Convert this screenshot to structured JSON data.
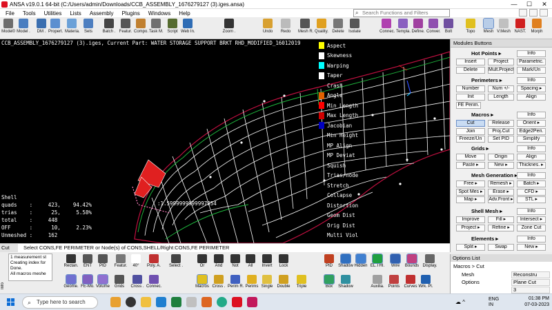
{
  "window": {
    "title": "ANSA v19.0.1 64-bit (C:/Users/admin/Downloads/CCB_ASSEMBLY_1676279127 (3).iges.ansa)",
    "minimize": "—",
    "maximize": "☐",
    "close": "✕"
  },
  "menu": [
    "File",
    "Tools",
    "Utilities",
    "Lists",
    "Assembly",
    "Plugins",
    "Windows",
    "Help"
  ],
  "search": {
    "placeholder": "Search Functions and Filters"
  },
  "toolbar": [
    {
      "label": "Model0",
      "icon": "model-icon",
      "color": "#6d6d6d"
    },
    {
      "label": "Model .",
      "icon": "model-browser-icon",
      "color": "#4a7ec0"
    },
    {
      "label": "DM .",
      "icon": "data-management-icon",
      "color": "#3b6fb0"
    },
    {
      "label": "Propert.",
      "icon": "properties-icon",
      "color": "#5c8fd0"
    },
    {
      "label": "Materia.",
      "icon": "materials-icon",
      "color": "#6ba1d8"
    },
    {
      "label": "Sets",
      "icon": "sets-icon",
      "color": "#4e7fc0"
    },
    {
      "label": "Batch .",
      "icon": "batch-icon",
      "color": "#444444"
    },
    {
      "label": "Featur.",
      "icon": "features-icon",
      "color": "#555555"
    },
    {
      "label": "Compo.",
      "icon": "components-icon",
      "color": "#c08030"
    },
    {
      "label": "Task M.",
      "icon": "task-manager-icon",
      "color": "#707070"
    },
    {
      "label": "Script",
      "icon": "script-icon",
      "color": "#556b2f"
    },
    {
      "label": "Web In.",
      "icon": "web-icon",
      "color": "#2f6db5"
    },
    {
      "label": "Zoom .",
      "icon": "zoom-icon",
      "color": "#333333"
    },
    {
      "label": "Undo",
      "icon": "undo-icon",
      "color": "#d8a030"
    },
    {
      "label": "Redo",
      "icon": "redo-icon",
      "color": "#bbbbbb"
    },
    {
      "label": "Mesh R.",
      "icon": "mesh-repair-icon",
      "color": "#555555"
    },
    {
      "label": "Quality.",
      "icon": "quality-icon",
      "color": "#e0a020"
    },
    {
      "label": "Delete",
      "icon": "delete-icon",
      "color": "#777777"
    },
    {
      "label": "Isolate",
      "icon": "isolate-icon",
      "color": "#555555"
    },
    {
      "label": "Connec.",
      "icon": "connections-icon",
      "color": "#b040b0"
    },
    {
      "label": "Templa.",
      "icon": "template-icon",
      "color": "#8a60c0"
    },
    {
      "label": "Define.",
      "icon": "define-icon",
      "color": "#a040a0"
    },
    {
      "label": "Conver.",
      "icon": "convert-icon",
      "color": "#9050b0"
    },
    {
      "label": "Bolt",
      "icon": "bolt-icon",
      "color": "#7050a0"
    },
    {
      "label": "Topo",
      "icon": "topo-icon",
      "color": "#e0c020"
    },
    {
      "label": "Mesh",
      "icon": "mesh-icon",
      "color": "#a0a0a0"
    },
    {
      "label": "V.Mesh",
      "icon": "volume-mesh-icon",
      "color": "#c0c0c0"
    },
    {
      "label": "NAST.",
      "icon": "nastran-icon",
      "color": "#d02020"
    },
    {
      "label": "Morph",
      "icon": "morph-icon",
      "color": "#e08020"
    }
  ],
  "viewport": {
    "title": "CCB_ASSEMBLY_1676279127 (3).iges,  Current Part: WATER STORAGE SUPPORT BRKT RHD_MODIFIED_16012019",
    "legend": [
      {
        "label": "Aspect",
        "color": "#ffff00"
      },
      {
        "label": "Skewness",
        "color": "#ffffff"
      },
      {
        "label": "Warping",
        "color": "#00ffff"
      },
      {
        "label": "Taper",
        "color": "#ffffff"
      },
      {
        "label": "Crash",
        "color": ""
      },
      {
        "label": "Angle",
        "color": "#e06000"
      },
      {
        "label": "Min Length",
        "color": "#ff0000"
      },
      {
        "label": "Max Length",
        "color": "#d00000"
      },
      {
        "label": "Jacobian",
        "color": "#0000c0"
      },
      {
        "label": "Min Height",
        "color": ""
      },
      {
        "label": "MP Align",
        "color": ""
      },
      {
        "label": "MP Deviat",
        "color": ""
      },
      {
        "label": "Squish",
        "color": ""
      },
      {
        "label": "Trias/node",
        "color": ""
      },
      {
        "label": "Stretch",
        "color": ""
      },
      {
        "label": "Collapse",
        "color": ""
      },
      {
        "label": "Distortion",
        "color": ""
      },
      {
        "label": "Geom Dist",
        "color": ""
      },
      {
        "label": "Orig Dist",
        "color": ""
      },
      {
        "label": "Multi Viol",
        "color": ""
      }
    ],
    "stats": [
      "Shell",
      "quads    :     423,    94.42%",
      "trias    :      25,     5.58%",
      "total    :     448",
      "OFF      :      10,     2.23%",
      "Unmeshed :     162"
    ],
    "measure": ":1.5999999999997954"
  },
  "modules": {
    "header": "Modules Buttons",
    "hot_points": {
      "title": "Hot Points ▸",
      "info": "Info",
      "buttons": [
        "Insert",
        "Project",
        "Parametric.",
        "Delete",
        "Mult.Project",
        "Mark/Un"
      ]
    },
    "perimeters": {
      "title": "Perimeters ▸",
      "info": "Info",
      "buttons": [
        "Number",
        "Num +/-",
        "Spacing ▸",
        "Init",
        "Length",
        "Align"
      ],
      "extra": "FE Perim."
    },
    "macros": {
      "title": "Macros ▸",
      "info": "Info",
      "buttons": [
        "Cut",
        "Release",
        "Orient ▸",
        "Join",
        "Proj.Cut",
        "Edge2Peri.",
        "Freeze/Un",
        "Set PID",
        "Simplify"
      ]
    },
    "grids": {
      "title": "Grids ▸",
      "info": "Info",
      "buttons": [
        "Move",
        "Origin",
        "Align",
        "Paste ▸",
        "New ▸",
        "Thicknes. ▸"
      ]
    },
    "mesh_generation": {
      "title": "Mesh Generation ▸",
      "info": "Info",
      "buttons": [
        "Free ▸",
        "Remesh ▸",
        "Batch ▸",
        "Spot Mes ▸",
        "Erase ▸",
        "CFD ▸",
        "Map ▸",
        "Adv.Front ▸",
        "STL ▸"
      ]
    },
    "shell_mesh": {
      "title": "Shell Mesh ▸",
      "info": "Info",
      "buttons": [
        "Improve",
        "Fill ▸",
        "Intersect ▸",
        "Project ▸",
        "Refine ▸",
        "Zone Cut"
      ]
    },
    "elements": {
      "title": "Elements ▸",
      "info": "Info",
      "buttons": [
        "Split ▸",
        "Swap",
        "New ▸"
      ]
    }
  },
  "command": {
    "tab": "Cut",
    "message": "Select CONS,FE PERIMETER or Node(s) of CONS,SHELL/Right:CONS,FE PERIMETER"
  },
  "info_lines": [
    "1 measurement st",
    "Creating index for",
    "Done.",
    "All macros meshe"
  ],
  "info_label": "Info",
  "bottom_top": [
    {
      "label": "Rectan.",
      "icon": "rectangle-select-icon",
      "color": "#333333"
    },
    {
      "label": "ENT",
      "icon": "entity-icon",
      "color": "#555555"
    },
    {
      "label": "PID",
      "icon": "pid-icon",
      "color": "#555555"
    },
    {
      "label": "Featur.",
      "icon": "feature-select-icon",
      "color": "#777777"
    },
    {
      "label": "40°",
      "icon": "angle-field-icon",
      "color": "#ffffff"
    },
    {
      "label": "Poly. A.",
      "icon": "polygon-icon",
      "color": "#c03030"
    },
    {
      "label": "Select .",
      "icon": "select-icon",
      "color": "#444444"
    },
    {
      "label": "Or",
      "icon": "or-icon",
      "color": "#333333"
    },
    {
      "label": "And",
      "icon": "and-icon",
      "color": "#333333"
    },
    {
      "label": "Not",
      "icon": "not-icon",
      "color": "#333333"
    },
    {
      "label": "All",
      "icon": "all-icon",
      "color": "#333333"
    },
    {
      "label": "Invert",
      "icon": "invert-icon",
      "color": "#333333"
    },
    {
      "label": "Lock",
      "icon": "lock-icon",
      "color": "#333333"
    },
    {
      "label": "PID",
      "icon": "pid-color-icon",
      "color": "#c04020"
    },
    {
      "label": "Shadow",
      "icon": "shadow-icon",
      "color": "#3070c0"
    },
    {
      "label": "Hidden",
      "icon": "hidden-icon",
      "color": "#4080d0"
    },
    {
      "label": "EL.THI.",
      "icon": "element-thickness-icon",
      "color": "#20a040"
    },
    {
      "label": "Wire",
      "icon": "wire-icon",
      "color": "#3060b0"
    },
    {
      "label": "Bounds",
      "icon": "bounds-icon",
      "color": "#c04080"
    },
    {
      "label": "Display.",
      "icon": "display-icon",
      "color": "#666666"
    }
  ],
  "bottom_bottom": [
    {
      "label": "Geome.",
      "icon": "geometry-icon",
      "color": "#7070d0"
    },
    {
      "label": "FE-Mo.",
      "icon": "fe-model-icon",
      "color": "#8060c0"
    },
    {
      "label": "Volume",
      "icon": "volume-icon",
      "color": "#9070d0"
    },
    {
      "label": "Grids",
      "icon": "grids-icon",
      "color": "#555555"
    },
    {
      "label": "Cross .",
      "icon": "cross-section-icon",
      "color": "#5050a0"
    },
    {
      "label": "Connec.",
      "icon": "connections-vis-icon",
      "color": "#7050b0"
    },
    {
      "label": "Macros",
      "icon": "macros-icon",
      "color": "#e0c020"
    },
    {
      "label": "Cross .",
      "icon": "cross-icon",
      "color": "#d0a020"
    },
    {
      "label": "Perim R.",
      "icon": "perimeter-r-icon",
      "color": "#4060c0"
    },
    {
      "label": "Perims",
      "icon": "perims-icon",
      "color": "#e0b020"
    },
    {
      "label": "Single",
      "icon": "single-icon",
      "color": "#e0c040"
    },
    {
      "label": "Double",
      "icon": "double-icon",
      "color": "#d0a020"
    },
    {
      "label": "Triple",
      "icon": "triple-icon",
      "color": "#e0c020"
    },
    {
      "label": "Box",
      "icon": "box-icon",
      "color": "#30a060"
    },
    {
      "label": "Shadow",
      "icon": "shadow2-icon",
      "color": "#3090a0"
    },
    {
      "label": "Auxilia.",
      "icon": "auxiliary-icon",
      "color": "#a0a0a0"
    },
    {
      "label": "Points",
      "icon": "points-icon",
      "color": "#c04040"
    },
    {
      "label": "Curves",
      "icon": "curves-icon",
      "color": "#c03030"
    },
    {
      "label": "Wrk. Pl.",
      "icon": "work-plane-icon",
      "color": "#2060b0"
    }
  ],
  "options": {
    "header": "Options List",
    "path": "Macros > Cut",
    "rows": [
      {
        "label": "Mesh",
        "value": "Reconstru"
      },
      {
        "label": "Options",
        "value": "Plane Cut"
      },
      {
        "label": "",
        "value": "3"
      }
    ]
  },
  "taskbar": {
    "search": "Type here to search",
    "lang": "ENG\nIN",
    "time": "01:38 PM",
    "date": "07-03-2023",
    "weather": "☁ ^"
  }
}
